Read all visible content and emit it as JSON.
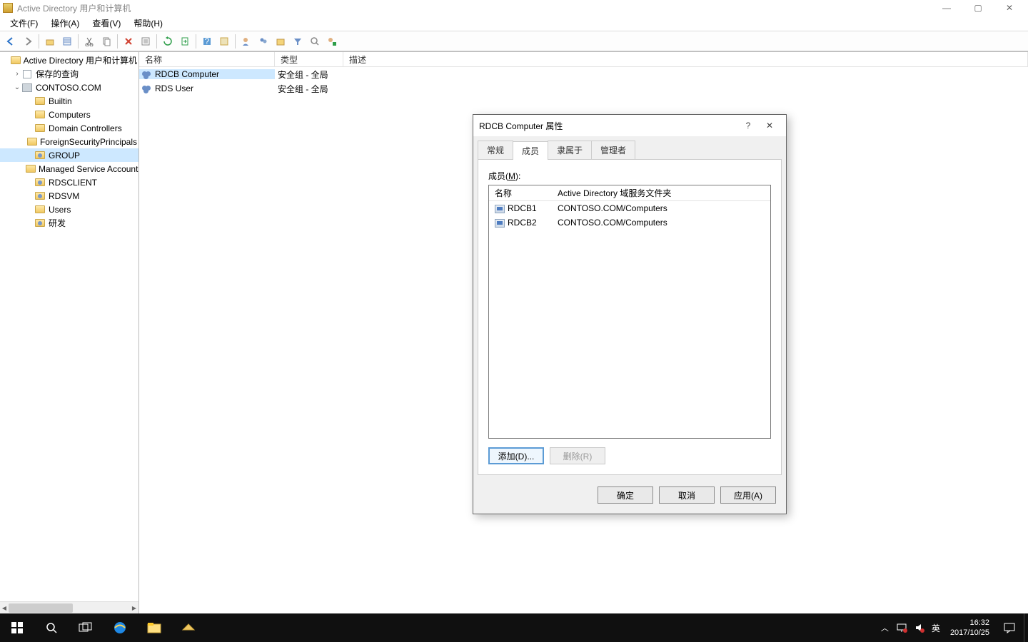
{
  "window": {
    "title": "Active Directory 用户和计算机",
    "controls": {
      "min": "—",
      "max": "▢",
      "close": "✕"
    }
  },
  "menu": {
    "file": "文件(F)",
    "action": "操作(A)",
    "view": "查看(V)",
    "help": "帮助(H)"
  },
  "tree": {
    "root": "Active Directory 用户和计算机",
    "saved_queries": "保存的查询",
    "domain": "CONTOSO.COM",
    "nodes": [
      "Builtin",
      "Computers",
      "Domain Controllers",
      "ForeignSecurityPrincipals",
      "GROUP",
      "Managed Service Accounts",
      "RDSCLIENT",
      "RDSVM",
      "Users",
      "研发"
    ]
  },
  "list": {
    "cols": {
      "name": "名称",
      "type": "类型",
      "desc": "描述"
    },
    "rows": [
      {
        "name": "RDCB Computer",
        "type": "安全组 - 全局"
      },
      {
        "name": "RDS User",
        "type": "安全组 - 全局"
      }
    ]
  },
  "dialog": {
    "title": "RDCB Computer 属性",
    "help": "?",
    "close": "✕",
    "tabs": {
      "general": "常规",
      "members": "成员",
      "memberof": "隶属于",
      "managedby": "管理者"
    },
    "members_label_pre": "成员(",
    "members_label_u": "M",
    "members_label_post": "):",
    "cols": {
      "name": "名称",
      "folder": "Active Directory 域服务文件夹"
    },
    "rows": [
      {
        "name": "RDCB1",
        "folder": "CONTOSO.COM/Computers"
      },
      {
        "name": "RDCB2",
        "folder": "CONTOSO.COM/Computers"
      }
    ],
    "add": "添加(D)...",
    "remove": "删除(R)",
    "ok": "确定",
    "cancel": "取消",
    "apply": "应用(A)"
  },
  "taskbar": {
    "ime": "英",
    "time": "16:32",
    "date": "2017/10/25"
  }
}
